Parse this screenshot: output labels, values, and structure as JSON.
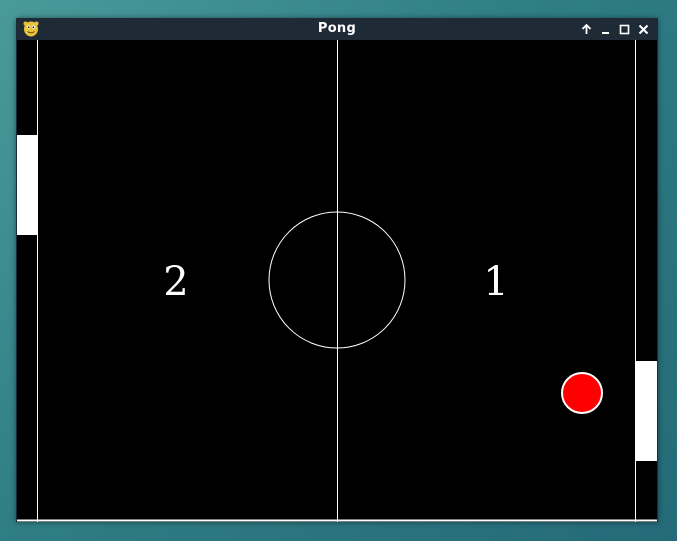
{
  "window": {
    "title": "Pong",
    "app_icon": "python-icon",
    "controls": [
      "keep-above-icon",
      "minimize-icon",
      "maximize-icon",
      "close-icon"
    ]
  },
  "game": {
    "scores": {
      "left": "2",
      "right": "1"
    },
    "colors": {
      "field": "#000000",
      "lines": "#ffffff",
      "ball": "#ff0000",
      "paddles": "#ffffff"
    }
  }
}
